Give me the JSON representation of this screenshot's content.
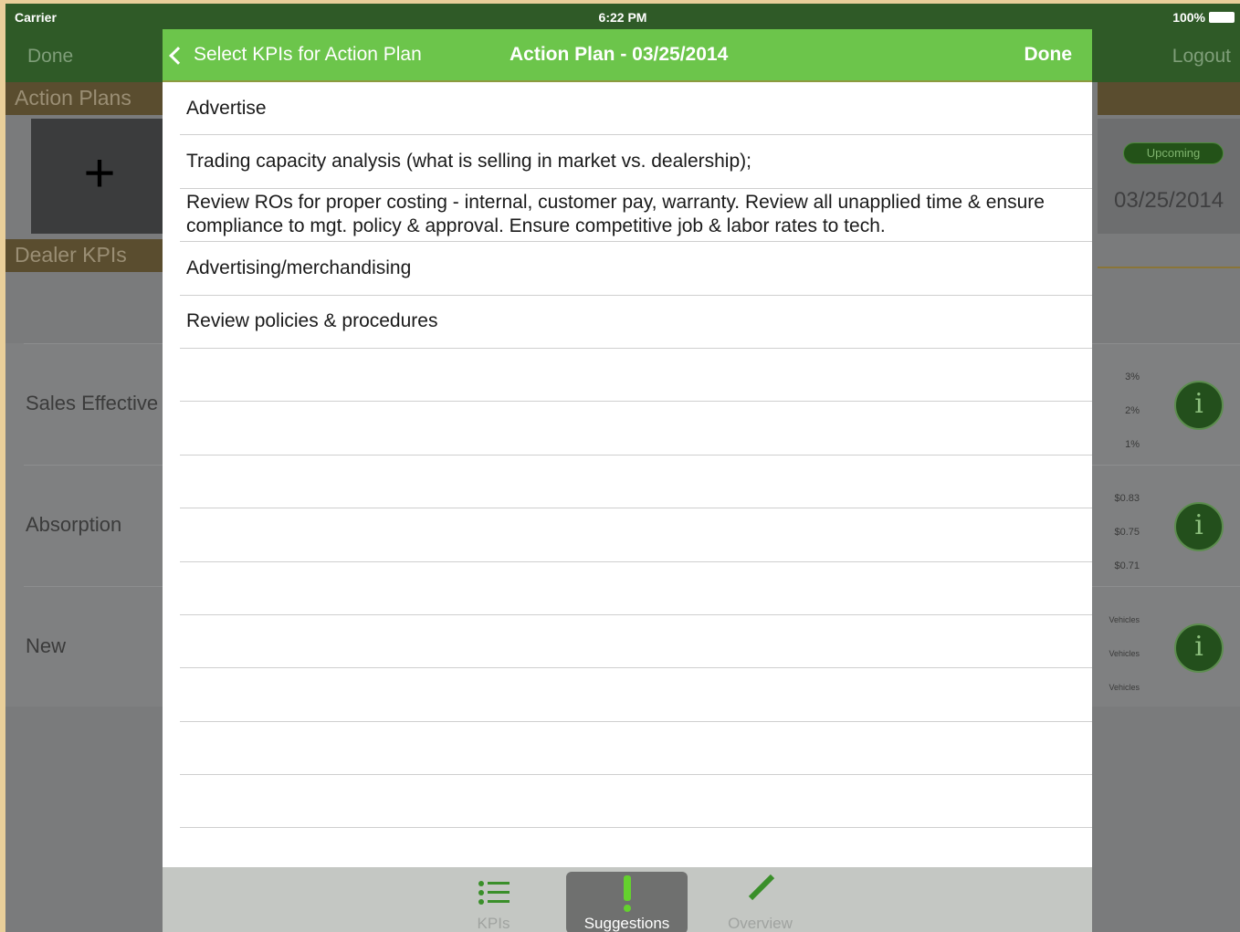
{
  "status_bar": {
    "carrier": "Carrier",
    "time": "6:22 PM",
    "battery": "100%"
  },
  "background": {
    "nav": {
      "left": "Done",
      "right": "Logout"
    },
    "action_plans_header": "Action Plans",
    "add_symbol": "+",
    "dealer_kpis_header": "Dealer KPIs",
    "plan_status": "Upcoming",
    "plan_date": "03/25/2014",
    "kpi_rows": [
      {
        "label": "Sales Effective",
        "ticks": [
          "3%",
          "2%",
          "1%"
        ]
      },
      {
        "label": "Absorption",
        "ticks": [
          "$0.83",
          "$0.75",
          "$0.71"
        ]
      },
      {
        "label": "New",
        "ticks": [
          "Vehicles",
          "Vehicles",
          "Vehicles"
        ]
      }
    ],
    "info_glyph": "i"
  },
  "modal": {
    "back_label": "Select KPIs for Action Plan",
    "title": "Action Plan - 03/25/2014",
    "done_label": "Done",
    "suggestions": [
      "Advertise",
      "Trading capacity analysis (what is selling in market vs. dealership);",
      "Review ROs for proper costing - internal,  customer pay, warranty.  Review all unapplied time & ensure compliance to mgt. policy & approval.  Ensure competitive job & labor rates to tech.",
      "Advertising/merchandising",
      "Review policies & procedures",
      "",
      "",
      "",
      "",
      "",
      "",
      "",
      "",
      "",
      ""
    ],
    "tabs": [
      {
        "label": "KPIs",
        "icon": "list-icon",
        "active": false
      },
      {
        "label": "Suggestions",
        "icon": "exclamation-icon",
        "active": true
      },
      {
        "label": "Overview",
        "icon": "pencil-icon",
        "active": false
      }
    ]
  },
  "colors": {
    "nav_green": "#6cc54b",
    "dark_green": "#2f5a27",
    "tabbar_gray": "#c4c7c3"
  }
}
